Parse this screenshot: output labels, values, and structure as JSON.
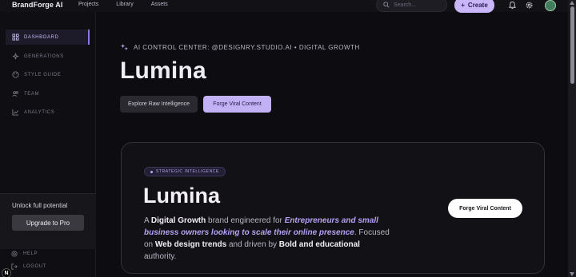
{
  "app": {
    "brand": "BrandForge AI"
  },
  "topnav": {
    "items": [
      "Projects",
      "Library",
      "Assets"
    ]
  },
  "search": {
    "placeholder": "Search..."
  },
  "create": {
    "label": "Create",
    "plus": "+"
  },
  "sidebar": {
    "items": [
      {
        "label": "DASHBOARD",
        "icon": "grid-icon",
        "active": true
      },
      {
        "label": "GENERATIONS",
        "icon": "sparkle-icon",
        "active": false
      },
      {
        "label": "STYLE GUIDE",
        "icon": "palette-icon",
        "active": false
      },
      {
        "label": "TEAM",
        "icon": "users-icon",
        "active": false
      },
      {
        "label": "ANALYTICS",
        "icon": "chart-icon",
        "active": false
      }
    ],
    "upgrade_text": "Unlock full potential",
    "upgrade_button": "Upgrade to Pro",
    "help": "HELP",
    "logout": "LOGOUT"
  },
  "main": {
    "subtitle": "AI CONTROL CENTER: @DESIGNRY.STUDIO.AI • DIGITAL GROWTH",
    "title": "Lumina",
    "explore_button": "Explore Raw Intelligence",
    "forge_button": "Forge Viral Content"
  },
  "card": {
    "badge": "STRATEGIC INTELLIGENCE",
    "title": "Lumina",
    "desc": {
      "t1": "A ",
      "b1": "Digital Growth",
      "t2": " brand engineered for ",
      "i1": "Entrepreneurs and small business owners looking to scale their online presence",
      "t3": ". Focused on ",
      "b2": "Web design trends",
      "t4": " and driven by ",
      "b3": "Bold and educational",
      "t5": " authority."
    },
    "button": "Forge Viral Content"
  },
  "colors": {
    "accent": "#c3b1f6",
    "background": "#0d0c10"
  },
  "corner_badge": "N"
}
